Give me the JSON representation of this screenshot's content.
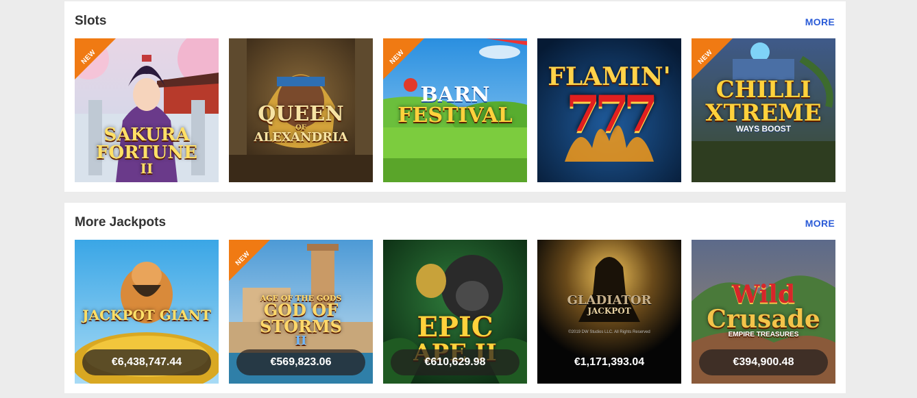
{
  "slots": {
    "title": "Slots",
    "more_label": "MORE",
    "games": [
      {
        "name": "SAKURA FORTUNE II",
        "line1": "SAKURA",
        "line2": "FORTUNE",
        "line3": "II",
        "is_new": true,
        "badge": "NEW"
      },
      {
        "name": "QUEEN OF ALEXANDRIA",
        "line1": "QUEEN",
        "line2": "OF",
        "line3": "ALEXANDRIA",
        "is_new": false
      },
      {
        "name": "BARN FESTIVAL",
        "line1": "BARN",
        "line2": "FESTIVAL",
        "is_new": true,
        "badge": "NEW"
      },
      {
        "name": "FLAMIN' 7",
        "line1": "FLAMIN'",
        "line2": "777",
        "is_new": false
      },
      {
        "name": "CHILLI XTREME WAYS BOOST",
        "line1": "CHILLI",
        "line2": "XTREME",
        "line3": "WAYS BOOST",
        "is_new": true,
        "badge": "NEW"
      }
    ]
  },
  "jackpots": {
    "title": "More Jackpots",
    "more_label": "MORE",
    "games": [
      {
        "name": "JACKPOT GIANT",
        "line1": "JACKPOT GIANT",
        "amount": "€6,438,747.44",
        "is_new": false
      },
      {
        "name": "AGE OF THE GODS GOD OF STORMS II",
        "line1": "AGE OF THE GODS",
        "line2": "GOD OF STORMS",
        "line3": "II",
        "amount": "€569,823.06",
        "is_new": true,
        "badge": "NEW"
      },
      {
        "name": "EPIC APE II",
        "line1": "EPIC",
        "line2": "APE II",
        "amount": "€610,629.98",
        "is_new": false
      },
      {
        "name": "GLADIATOR JACKPOT",
        "line1": "GLADIATOR",
        "line2": "JACKPOT",
        "copyright": "©2019 DW Studios LLC. All Rights Reserved",
        "amount": "€1,171,393.04",
        "is_new": false
      },
      {
        "name": "WILD CRUSADE EMPIRE TREASURES",
        "line1": "Wild",
        "line2": "Crusade",
        "line3": "EMPIRE TREASURES",
        "amount": "€394,900.48",
        "is_new": false
      }
    ]
  },
  "colors": {
    "page_bg": "#ececec",
    "panel_bg": "#ffffff",
    "title_text": "#333333",
    "more_link": "#2a5bd7",
    "new_ribbon": "#f07a13",
    "jackpot_pill": "#231e1e"
  }
}
